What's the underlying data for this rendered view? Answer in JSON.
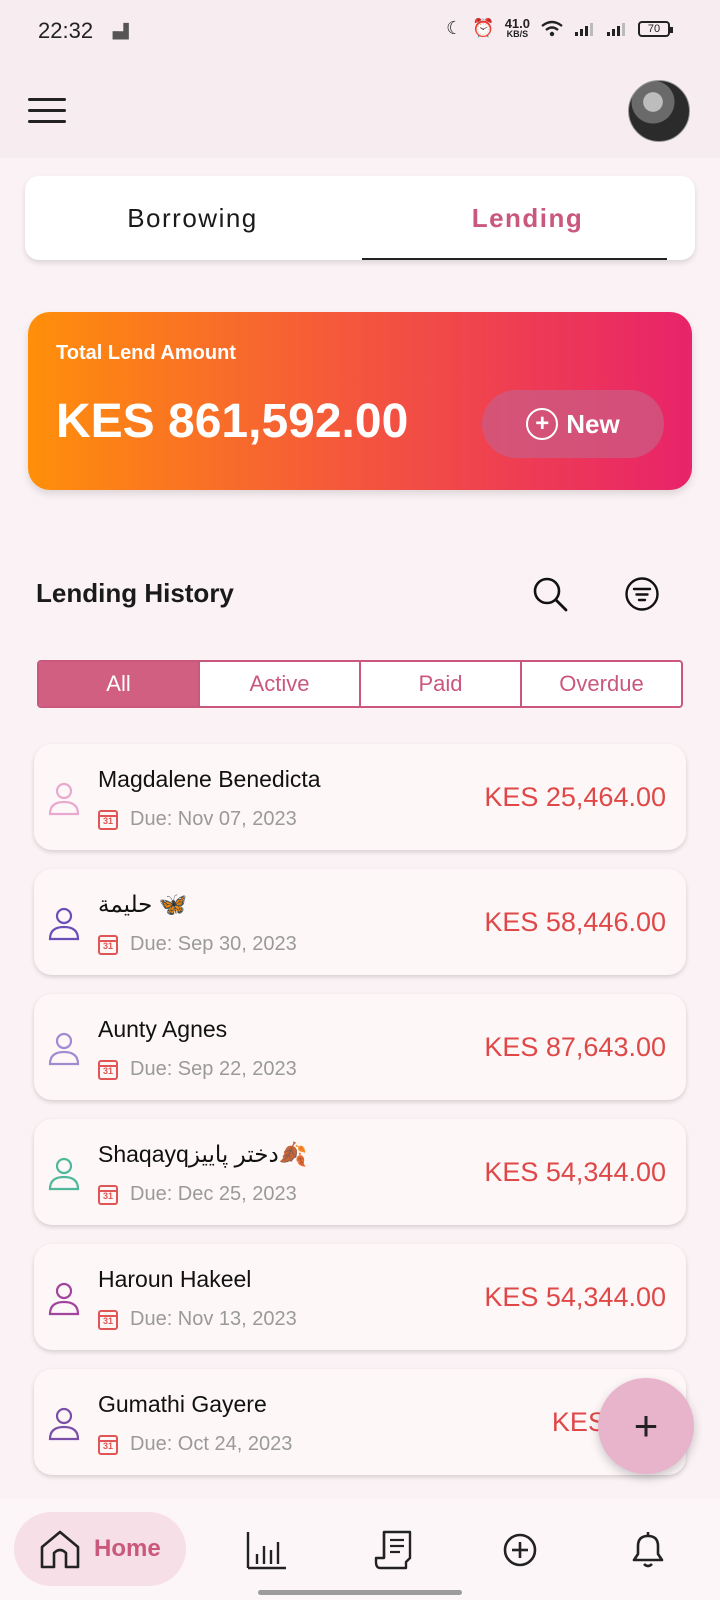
{
  "status_bar": {
    "time": "22:32",
    "speed_value": "41.0",
    "speed_unit": "KB/S",
    "battery": "70"
  },
  "header": {
    "menu_icon": "hamburger-icon",
    "avatar_icon": "user-avatar"
  },
  "segment": {
    "tabs": [
      {
        "label": "Borrowing",
        "active": false
      },
      {
        "label": "Lending",
        "active": true
      }
    ]
  },
  "summary": {
    "label": "Total Lend Amount",
    "amount": "KES 861,592.00",
    "new_button": "New",
    "gradient_colors": [
      "#ff8f0a",
      "#f4553e",
      "#e8236a"
    ]
  },
  "history": {
    "title": "Lending History",
    "filters": [
      {
        "label": "All",
        "selected": true
      },
      {
        "label": "Active",
        "selected": false
      },
      {
        "label": "Paid",
        "selected": false
      },
      {
        "label": "Overdue",
        "selected": false
      }
    ],
    "items": [
      {
        "name": "Magdalene Benedicta",
        "due": "Due: Nov 07, 2023",
        "amount": "KES 25,464.00",
        "icon_color": "#e9a9cf"
      },
      {
        "name": "حليمة 🦋",
        "due": "Due: Sep 30, 2023",
        "amount": "KES 58,446.00",
        "icon_color": "#6a4fb8"
      },
      {
        "name": "Aunty Agnes",
        "due": "Due: Sep 22, 2023",
        "amount": "KES 87,643.00",
        "icon_color": "#a08ad0"
      },
      {
        "name": "Shaqayqدختر پاییز🍂",
        "due": "Due: Dec 25, 2023",
        "amount": "KES 54,344.00",
        "icon_color": "#4fb89a"
      },
      {
        "name": "Haroun Hakeel",
        "due": "Due: Nov 13, 2023",
        "amount": "KES 54,344.00",
        "icon_color": "#a0449c"
      },
      {
        "name": "Gumathi Gayere",
        "due": "Due: Oct 24, 2023",
        "amount": "KES 84,6",
        "icon_color": "#7a4fa8"
      }
    ]
  },
  "fab": {
    "label": "+"
  },
  "bottom_nav": {
    "home_label": "Home",
    "icons": [
      "home-icon",
      "bar-chart-icon",
      "receipt-icon",
      "add-circle-icon",
      "bell-icon"
    ]
  },
  "colors": {
    "accent": "#c9587c",
    "amount": "#e04848"
  }
}
